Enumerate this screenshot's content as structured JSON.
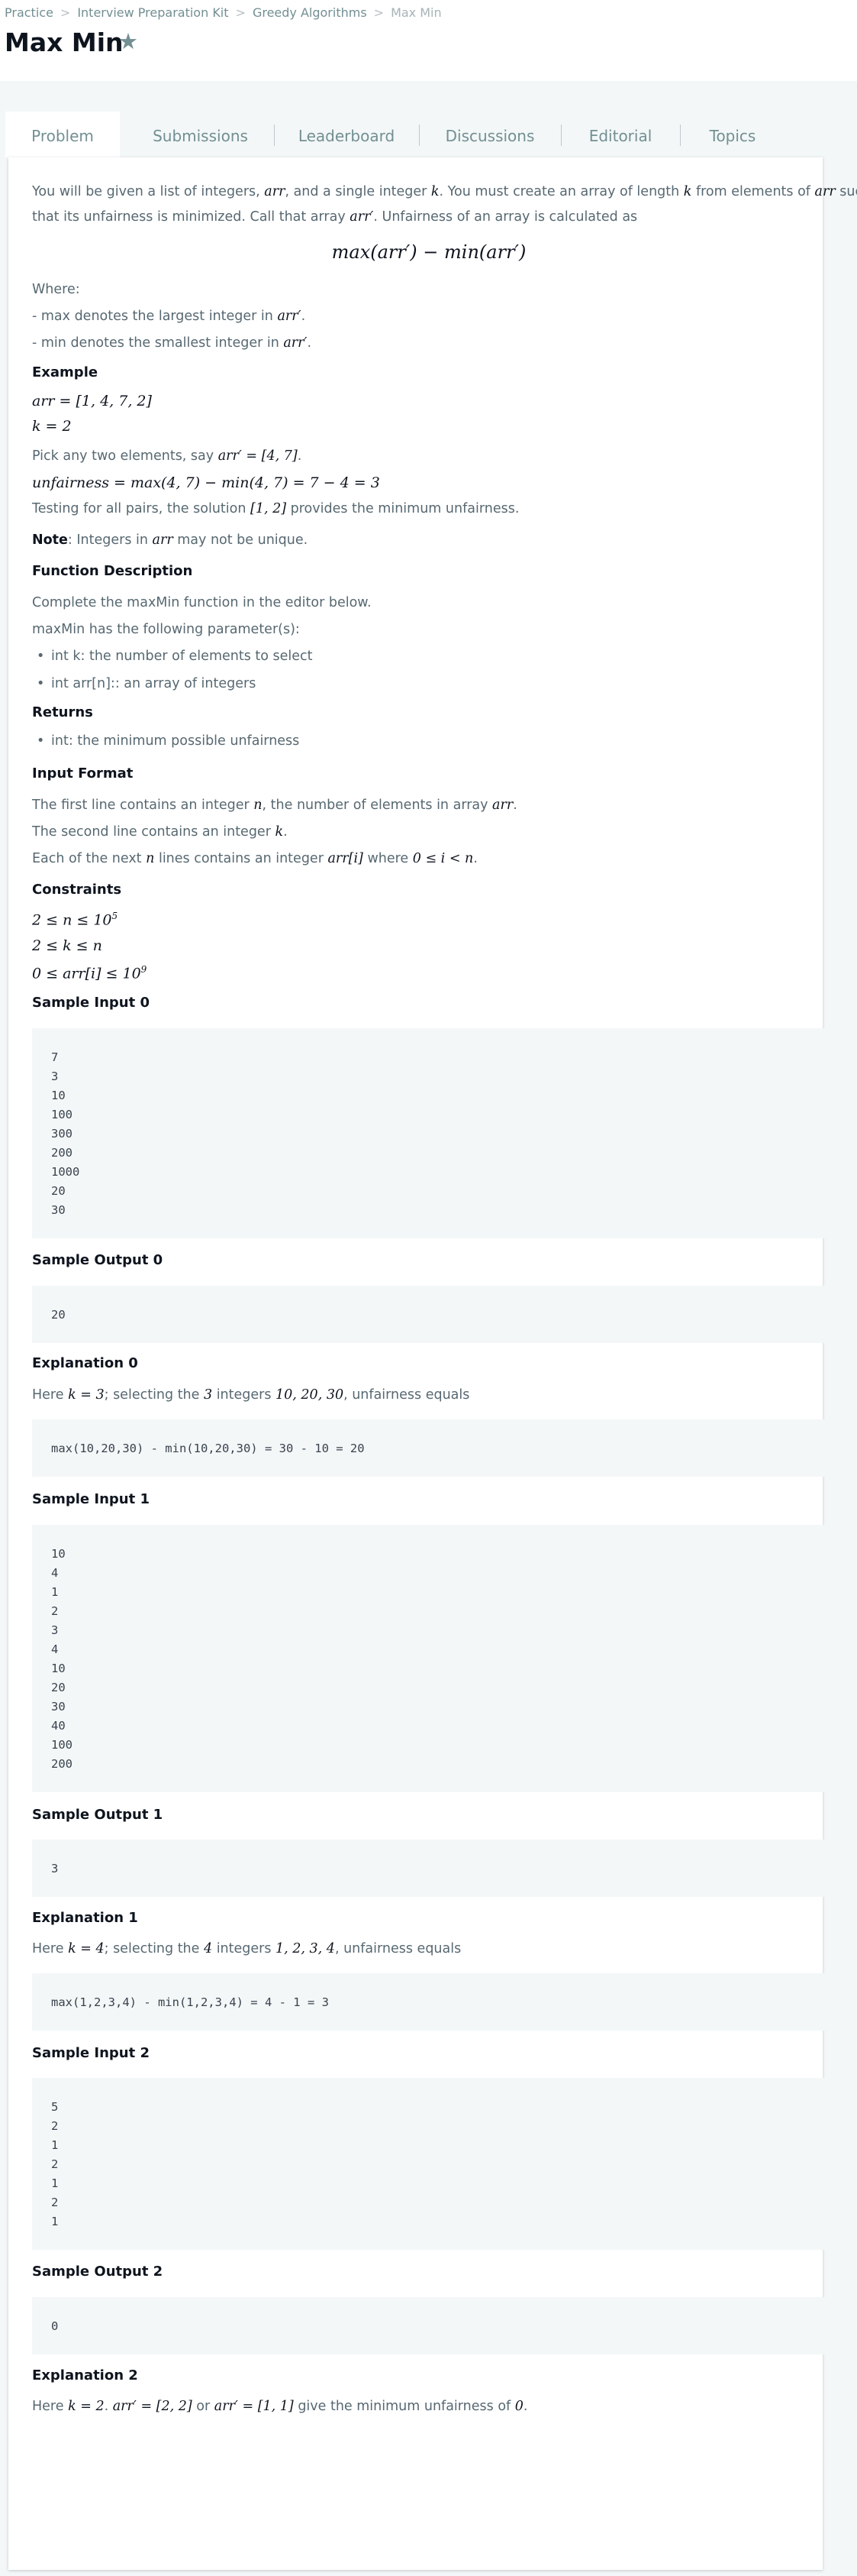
{
  "breadcrumb": {
    "items": [
      "Practice",
      "Interview Preparation Kit",
      "Greedy Algorithms"
    ],
    "current": "Max Min"
  },
  "page_title": "Max Min",
  "tabs": [
    "Problem",
    "Submissions",
    "Leaderboard",
    "Discussions",
    "Editorial",
    "Topics"
  ],
  "active_tab": "Problem",
  "problem": {
    "intro_1a": "You will be given a list of integers, ",
    "intro_1b": ", and a single integer ",
    "intro_1c": ". You must create an array of length ",
    "intro_1d": " from elements of ",
    "intro_1e": " such",
    "intro_2a": "that its unfairness is minimized. Call that array ",
    "intro_2b": ". Unfairness of an array is calculated as",
    "formula": "max(arr′) − min(arr′)",
    "where": "Where:",
    "where_max": "- max denotes the largest integer in ",
    "where_min": "- min denotes the smallest integer in ",
    "example_heading": "Example",
    "ex_arr": "arr = [1, 4, 7, 2]",
    "ex_k": "k = 2",
    "pick_text": "Pick any two elements, say ",
    "pick_math": "arr′ = [4, 7]",
    "unfair_math": "unfairness = max(4, 7) − min(4, 7) = 7 − 4 = 3",
    "testing_a": "Testing for all pairs, the solution ",
    "testing_math": "[1, 2]",
    "testing_b": " provides the minimum unfairness.",
    "note_label": "Note",
    "note_a": ": Integers in ",
    "note_b": " may not be unique.",
    "func_heading": "Function Description",
    "func_text": "Complete the maxMin function in the editor below.",
    "params_text": "maxMin has the following parameter(s):",
    "params": [
      "int k: the number of elements to select",
      "int arr[n]:: an array of integers"
    ],
    "returns_heading": "Returns",
    "returns": [
      "int: the minimum possible unfairness"
    ],
    "input_heading": "Input Format",
    "input_1a": "The first line contains an integer ",
    "input_1b": ", the number of elements in array ",
    "input_2": "The second line contains an integer ",
    "input_3a": "Each of the next ",
    "input_3b": " lines contains an integer ",
    "input_3c": " where ",
    "input_3math": "0 ≤ i < n",
    "constraints_heading": "Constraints",
    "c1": "2 ≤ n ≤ 10",
    "c1sup": "5",
    "c2": "2 ≤ k ≤ n",
    "c3": "0 ≤ arr[i] ≤ 10",
    "c3sup": "9",
    "var_arr": "arr",
    "var_k": "k",
    "var_n": "n",
    "var_arrp": "arr′",
    "var_arri": "arr[i]"
  },
  "samples": {
    "in0_heading": "Sample Input 0",
    "in0": "7\n3\n10\n100\n300\n200\n1000\n20\n30",
    "out0_heading": "Sample Output 0",
    "out0": "20",
    "exp0_heading": "Explanation 0",
    "exp0_a": "Here ",
    "exp0_k": "k = 3",
    "exp0_b": "; selecting the ",
    "exp0_n": "3",
    "exp0_c": " integers ",
    "exp0_vals": "10, 20, 30",
    "exp0_d": ", unfairness equals",
    "exp0_code": "max(10,20,30) - min(10,20,30) = 30 - 10 = 20",
    "in1_heading": "Sample Input 1",
    "in1": "10\n4\n1\n2\n3\n4\n10\n20\n30\n40\n100\n200",
    "out1_heading": "Sample Output 1",
    "out1": "3",
    "exp1_heading": "Explanation 1",
    "exp1_a": "Here ",
    "exp1_k": "k = 4",
    "exp1_b": "; selecting the ",
    "exp1_n": "4",
    "exp1_c": " integers ",
    "exp1_vals": "1, 2, 3, 4",
    "exp1_d": ", unfairness equals",
    "exp1_code": "max(1,2,3,4) - min(1,2,3,4) = 4 - 1 = 3",
    "in2_heading": "Sample Input 2",
    "in2": "5\n2\n1\n2\n1\n2\n1",
    "out2_heading": "Sample Output 2",
    "out2": "0",
    "exp2_heading": "Explanation 2",
    "exp2_a": "Here ",
    "exp2_k": "k = 2",
    "exp2_b": ". ",
    "exp2_m1": "arr′ = [2, 2]",
    "exp2_c": " or ",
    "exp2_m2": "arr′ = [1, 1]",
    "exp2_d": " give the minimum unfairness of ",
    "exp2_zero": "0",
    "exp2_e": "."
  }
}
